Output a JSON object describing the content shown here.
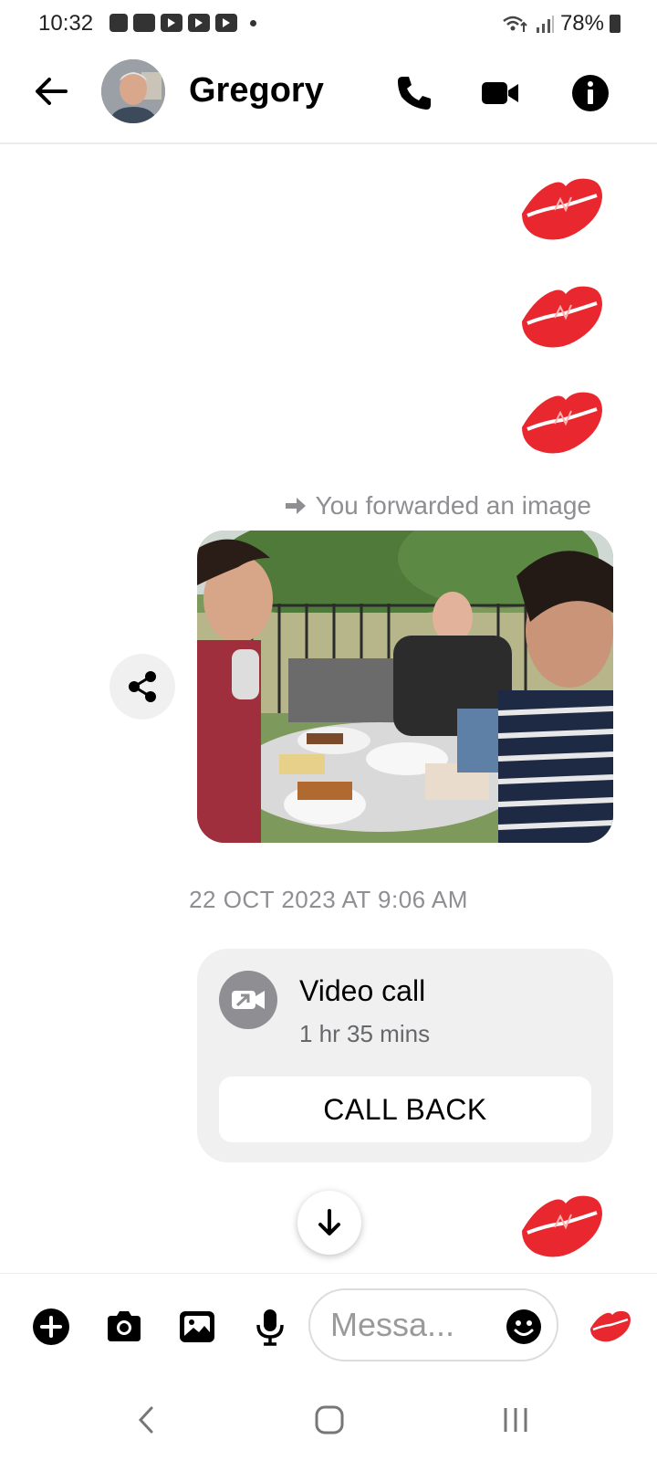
{
  "status_bar": {
    "time": "10:32",
    "battery": "78%"
  },
  "header": {
    "contact_name": "Gregory"
  },
  "conversation": {
    "forwarded_label": "You forwarded an image",
    "timestamp": "22 OCT 2023 AT 9:06 AM",
    "video_call": {
      "title": "Video call",
      "duration": "1 hr 35 mins",
      "call_back_label": "CALL BACK"
    }
  },
  "composer": {
    "placeholder": "Messa..."
  },
  "colors": {
    "lips_red": "#e8282e",
    "accent_gray": "#8e8e93",
    "bubble_bg": "#f0f0f0"
  }
}
